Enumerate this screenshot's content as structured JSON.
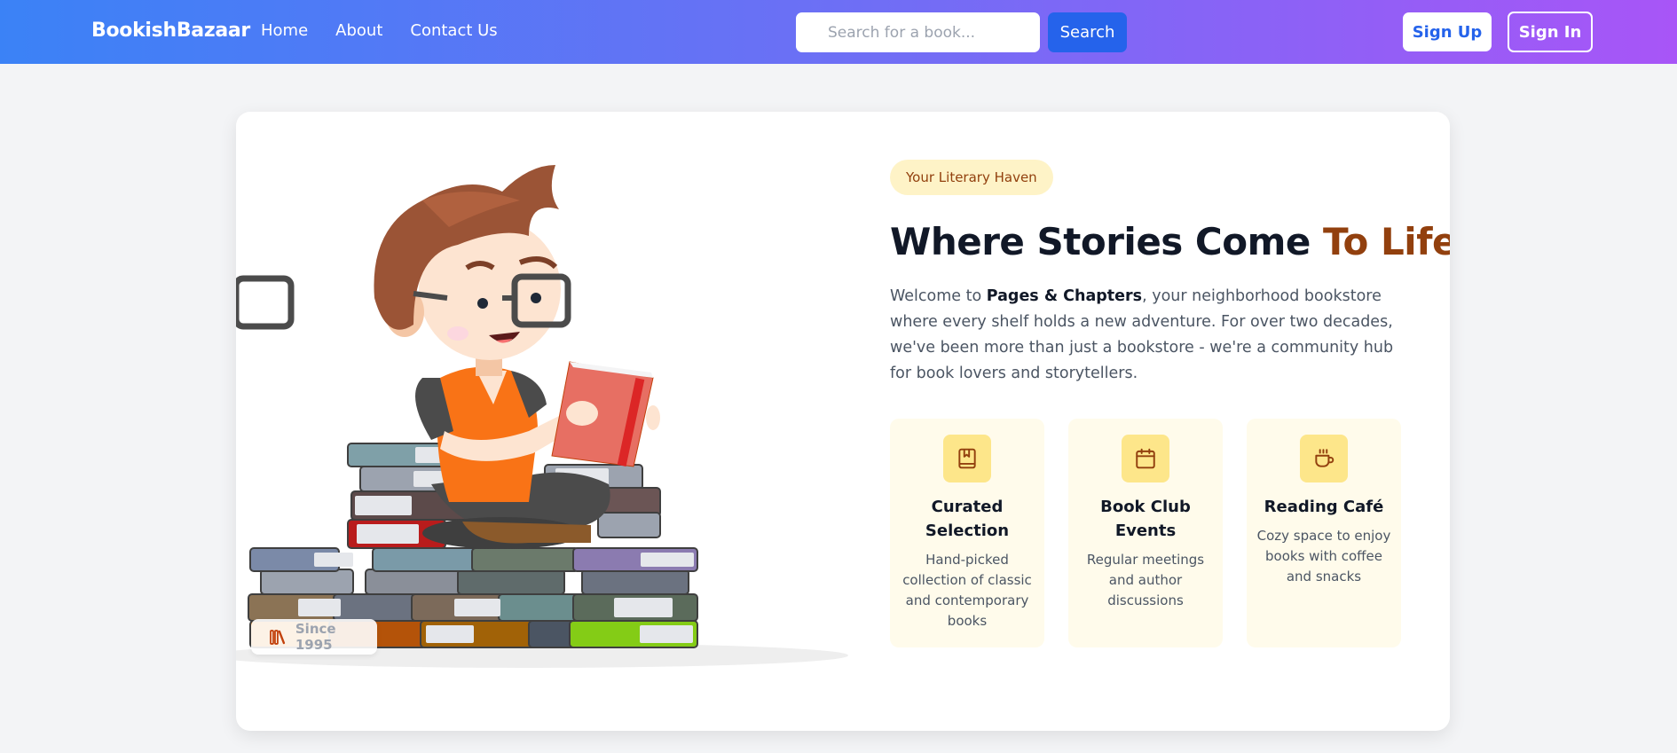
{
  "nav": {
    "brand": "BookishBazaar",
    "links": [
      "Home",
      "About",
      "Contact Us"
    ],
    "search_placeholder": "Search for a book...",
    "search_label": "Search",
    "signup_label": "Sign Up",
    "signin_label": "Sign In"
  },
  "hero": {
    "tag": "Your Literary Haven",
    "headline_main": "Where Stories Come ",
    "headline_accent": "To Life",
    "intro_prefix": "Welcome to ",
    "intro_bold": "Pages & Chapters",
    "intro_suffix": ", your neighborhood bookstore where every shelf holds a new adventure. For over two decades, we've been more than just a bookstore - we're a community hub for book lovers and storytellers.",
    "since_label": "Since 1995"
  },
  "features": [
    {
      "icon": "bookmark-book-icon",
      "title": "Curated Selection",
      "desc": "Hand-picked collection of classic and contemporary books"
    },
    {
      "icon": "calendar-icon",
      "title": "Book Club Events",
      "desc": "Regular meetings and author discussions"
    },
    {
      "icon": "coffee-cup-icon",
      "title": "Reading Café",
      "desc": "Cozy space to enjoy books with coffee and snacks"
    }
  ],
  "colors": {
    "nav_gradient_start": "#3b82f6",
    "nav_gradient_end": "#a855f7",
    "accent": "#92400e",
    "feature_bg": "#fffbeb",
    "feature_icon_bg": "#fde68a"
  }
}
